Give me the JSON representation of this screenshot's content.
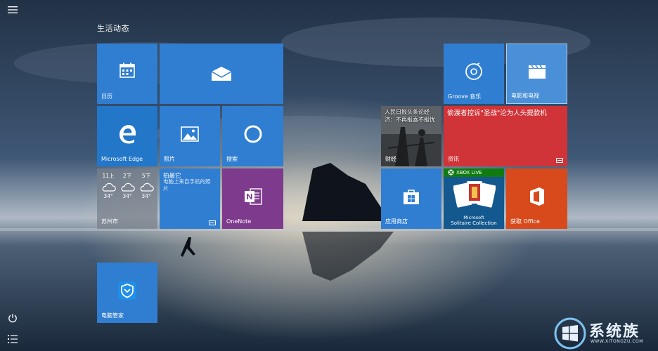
{
  "start": {
    "group_title": "生活动态",
    "tiles": {
      "calendar": "日历",
      "mail": "",
      "edge": "Microsoft Edge",
      "photos": "照片",
      "search": "搜索",
      "weather": {
        "city": "苏州市",
        "forecast": [
          {
            "time": "11上",
            "temp": "34°"
          },
          {
            "time": "2下",
            "temp": "34°"
          },
          {
            "time": "5下",
            "temp": "34°"
          }
        ]
      },
      "camera_app": {
        "title": "拍最它",
        "subtitle": "电脑上来自手机的照片"
      },
      "onenote": "OneNote",
      "groove": "Groove 音乐",
      "movies": "电影和电视",
      "photo_news": {
        "headline": "人民日报头条论经济：不再报喜不报忧",
        "label": "财经"
      },
      "news": {
        "headline": "偷渡者控诉\"圣战\"沦为人头提款机",
        "label": "资讯"
      },
      "store": "应用商店",
      "solitaire": {
        "badge": "XBOX LIVE",
        "brand": "Microsoft",
        "title": "Solitaire Collection"
      },
      "office": "获取 Office",
      "tencent": "电脑管家"
    }
  },
  "rail": {
    "menu_icon": "hamburger-icon",
    "power_icon": "power-icon",
    "all_apps_icon": "all-apps-icon"
  },
  "watermark": {
    "title": "系统族",
    "url": "WWW.XITONGZU.COM"
  },
  "colors": {
    "tile_blue": "#2f7ed1",
    "onenote": "#7e3a8c",
    "news_red": "#d13438",
    "office": "#d84a1b"
  }
}
